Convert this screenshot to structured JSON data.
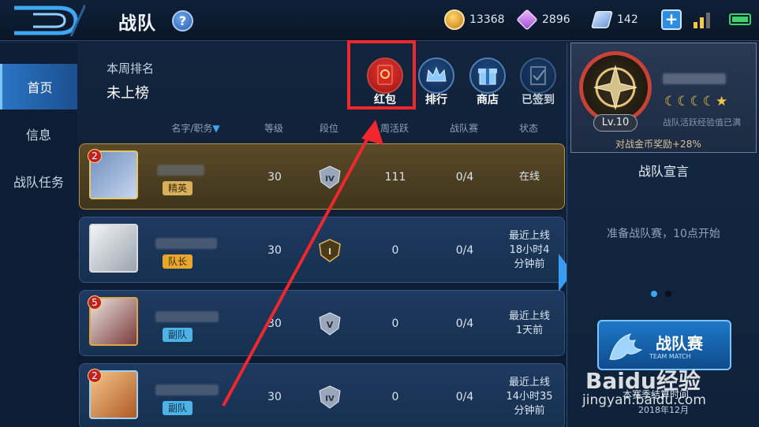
{
  "header": {
    "title": "战队",
    "help": "?",
    "gold": "13368",
    "diamond": "2896",
    "coupon": "142",
    "plus": "+"
  },
  "nav": {
    "items": [
      {
        "label": "首页",
        "active": true
      },
      {
        "label": "信息",
        "active": false
      },
      {
        "label": "战队任务",
        "active": false
      }
    ]
  },
  "rank": {
    "label": "本周排名",
    "value": "未上榜"
  },
  "actions": [
    {
      "label": "红包",
      "icon": "red-envelope-icon"
    },
    {
      "label": "排行",
      "icon": "crown-icon"
    },
    {
      "label": "商店",
      "icon": "gift-icon"
    },
    {
      "label": "已签到",
      "icon": "checkin-icon"
    }
  ],
  "table": {
    "columns": [
      "名字/职务",
      "等级",
      "段位",
      "周活跃",
      "战队赛",
      "状态"
    ],
    "sort_arrow": "▼",
    "rows": [
      {
        "badge": "2",
        "role": "精英",
        "level": "30",
        "tier": "IV",
        "active": "111",
        "match": "0/4",
        "status": [
          "在线"
        ],
        "self": true
      },
      {
        "badge": "",
        "role": "队长",
        "level": "30",
        "tier": "I",
        "active": "0",
        "match": "0/4",
        "status": [
          "最近上线",
          "18小时4",
          "分钟前"
        ],
        "self": false
      },
      {
        "badge": "5",
        "role": "副队",
        "level": "30",
        "tier": "V",
        "active": "0",
        "match": "0/4",
        "status": [
          "最近上线",
          "1天前"
        ],
        "self": false
      },
      {
        "badge": "2",
        "role": "副队",
        "level": "30",
        "tier": "IV",
        "active": "0",
        "match": "0/4",
        "status": [
          "最近上线",
          "14小时35",
          "分钟前"
        ],
        "self": false
      }
    ]
  },
  "team": {
    "level": "Lv.10",
    "moons": "☾☾☾☾★",
    "exp": "战队活跃经验值已满",
    "bonus": "对战金币奖励+28%",
    "declaration_title": "战队宣言",
    "declaration": "准备战队赛，10点开始",
    "match_button": "战队赛",
    "match_sub": "TEAM MATCH",
    "season_text": "本赛季结算时间",
    "season_date": "2018年12月"
  },
  "watermark": {
    "logo": "Bai",
    "logo_mid": "du",
    "logo_tail": "经验",
    "url": "jingyan.baidu.com"
  },
  "colors": {
    "highlight": "#f0272d",
    "accent": "#2a74c4",
    "gold_row": "#5a4a27"
  }
}
